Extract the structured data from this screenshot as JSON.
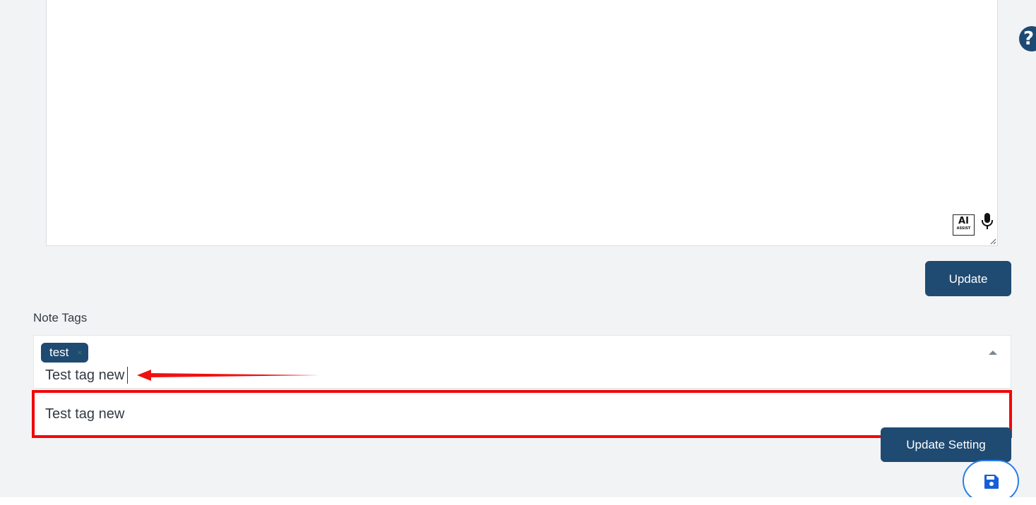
{
  "editor": {
    "ai_assist_main": "AI",
    "ai_assist_sub": "ASSIST",
    "mic_icon": "microphone-icon"
  },
  "help": {
    "icon": "question-mark-icon",
    "glyph": "?"
  },
  "update_button": {
    "label": "Update"
  },
  "note_tags": {
    "label": "Note Tags",
    "selected_tags": [
      {
        "label": "test",
        "remove_glyph": "×"
      }
    ],
    "input_value": "Test tag new",
    "dropdown_options": [
      "Test tag new"
    ]
  },
  "update_setting_button": {
    "label": "Update Setting"
  },
  "save_button": {
    "icon": "floppy-disk-icon"
  },
  "colors": {
    "primary": "#1f4a72",
    "highlight": "#f20808",
    "fab_border": "#2a7ee6",
    "background": "#f2f3f5"
  }
}
